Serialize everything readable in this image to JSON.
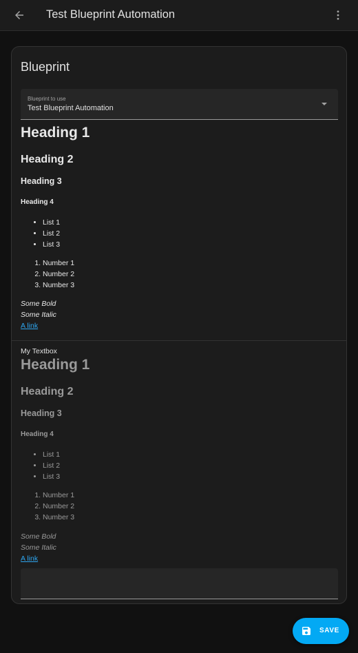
{
  "topbar": {
    "title": "Test Blueprint Automation",
    "back_icon": "arrow-left-icon",
    "menu_icon": "dots-vertical-icon"
  },
  "card": {
    "title": "Blueprint",
    "select": {
      "label": "Blueprint to use",
      "value": "Test Blueprint Automation"
    },
    "description": {
      "h1": "Heading 1",
      "h2": "Heading 2",
      "h3": "Heading 3",
      "h4": "Heading 4",
      "bullets": [
        "List 1",
        "List 2",
        "List 3"
      ],
      "numbers": [
        "Number 1",
        "Number 2",
        "Number 3"
      ],
      "bold": "Some Bold",
      "italic": "Some Italic",
      "link": "A link"
    },
    "textbox": {
      "label": "My Textbox",
      "description": {
        "h1": "Heading 1",
        "h2": "Heading 2",
        "h3": "Heading 3",
        "h4": "Heading 4",
        "bullets": [
          "List 1",
          "List 2",
          "List 3"
        ],
        "numbers": [
          "Number 1",
          "Number 2",
          "Number 3"
        ],
        "bold": "Some Bold",
        "italic": "Some Italic",
        "link": "A link"
      },
      "value": ""
    }
  },
  "fab": {
    "label": "SAVE",
    "icon": "content-save-icon"
  },
  "colors": {
    "background": "#111111",
    "surface": "#1c1c1c",
    "accent": "#03a9f4",
    "link": "#2ea6f0"
  }
}
